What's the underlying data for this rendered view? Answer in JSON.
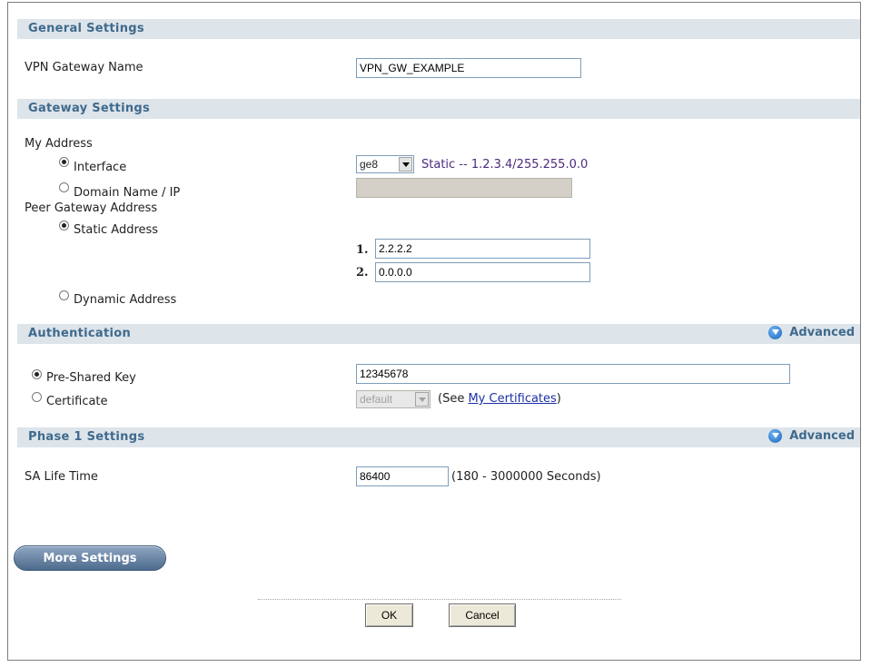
{
  "general": {
    "section_title": "General Settings",
    "vpn_gateway_name_label": "VPN Gateway Name",
    "vpn_gateway_name_value": "VPN_GW_EXAMPLE"
  },
  "gateway": {
    "section_title": "Gateway Settings",
    "my_address_label": "My Address",
    "interface_label": "Interface",
    "interface_selected": "ge8",
    "interface_status": "Static -- 1.2.3.4/255.255.0.0",
    "domain_label": "Domain Name / IP",
    "domain_value": "",
    "peer_label": "Peer Gateway Address",
    "static_label": "Static Address",
    "peer1_num": "1.",
    "peer1_value": "2.2.2.2",
    "peer2_num": "2.",
    "peer2_value": "0.0.0.0",
    "dynamic_label": "Dynamic Address"
  },
  "auth": {
    "section_title": "Authentication",
    "advanced_label": "Advanced",
    "psk_label": "Pre-Shared Key",
    "psk_value": "12345678",
    "cert_label": "Certificate",
    "cert_selected": "default",
    "see_prefix": "(See ",
    "see_link": "My Certificates",
    "see_suffix": ")"
  },
  "phase1": {
    "section_title": "Phase 1 Settings",
    "advanced_label": "Advanced",
    "sa_label": "SA Life Time",
    "sa_value": "86400",
    "sa_range": "(180 - 3000000 Seconds)"
  },
  "buttons": {
    "more_settings": "More Settings",
    "ok": "OK",
    "cancel": "Cancel"
  },
  "icons": [
    "info-advanced-icon",
    "dropdown-arrow-icon",
    "radio-button"
  ],
  "colors": {
    "section_bg": "#dde4ea",
    "section_text": "#3f6a8d",
    "status_text": "#4b2b7f",
    "link": "#1c2fa7"
  }
}
